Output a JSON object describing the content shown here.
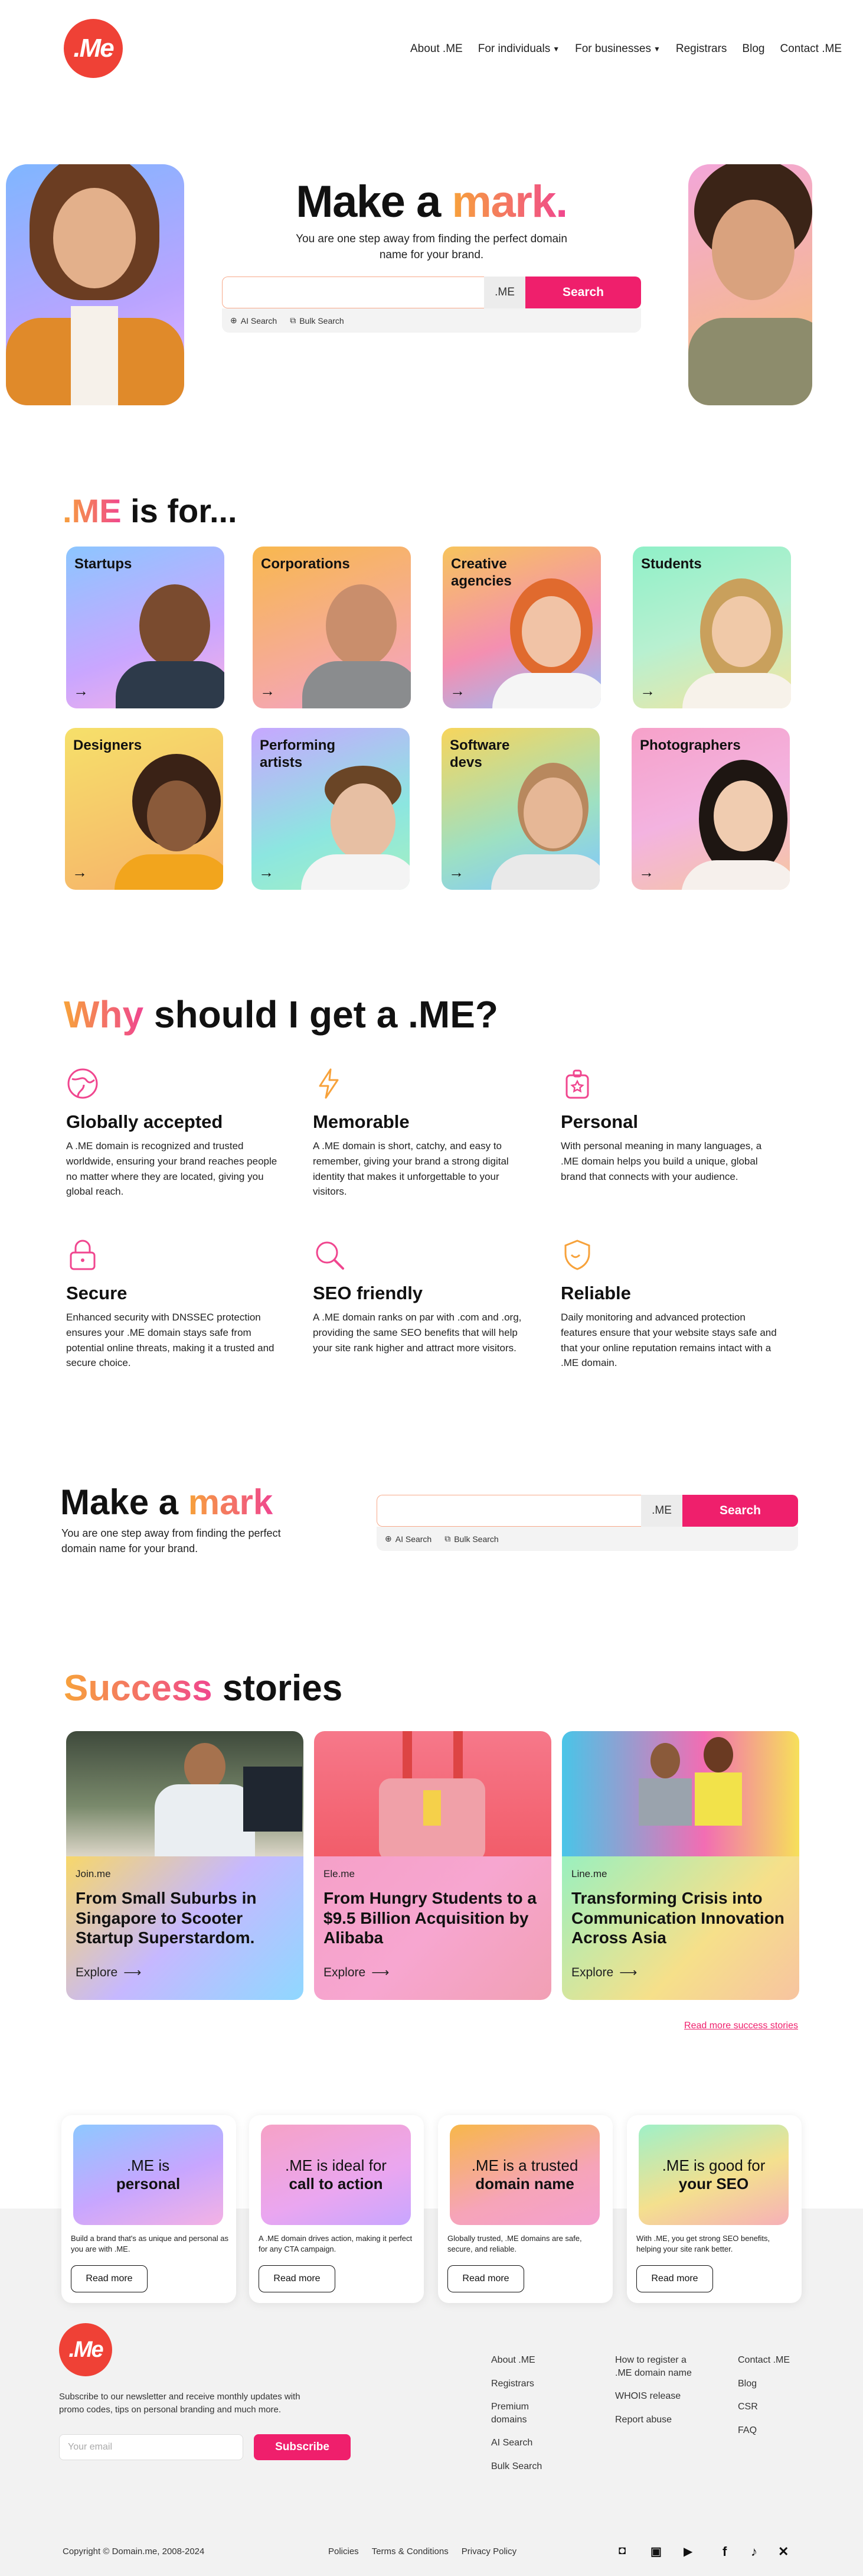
{
  "brand": {
    "logo_text": ".Me",
    "accent": "#ef4136",
    "pink": "#ef1f6c",
    "orange": "#f7a23b"
  },
  "nav": {
    "items": [
      "About .ME",
      "For individuals",
      "For businesses",
      "Registrars",
      "Blog",
      "Contact .ME"
    ]
  },
  "hero": {
    "title_a": "Make a ",
    "title_b": "mark.",
    "subtitle": "You are one step away from finding the perfect domain name for your brand.",
    "search_placeholder": "",
    "tld": ".ME",
    "search_label": "Search",
    "ai_search": "AI Search",
    "bulk_search": "Bulk Search"
  },
  "me_is_for": {
    "title_a": ".ME",
    "title_b": " is for...",
    "cards": [
      "Startups",
      "Corporations",
      "Creative agencies",
      "Students",
      "Designers",
      "Performing artists",
      "Software devs",
      "Photographers"
    ]
  },
  "why": {
    "title_a": "Why",
    "title_b": " should I get a .ME?",
    "features": [
      {
        "icon": "globe-icon",
        "title": "Globally accepted",
        "text": "A .ME domain is recognized and trusted worldwide, ensuring your brand reaches people no matter where they are located, giving you global reach."
      },
      {
        "icon": "lightning-icon",
        "title": "Memorable",
        "text": "A .ME domain is short, catchy, and easy to remember, giving your brand a strong digital identity that makes it unforgettable to your visitors."
      },
      {
        "icon": "badge-icon",
        "title": "Personal",
        "text": "With personal meaning in many languages, a .ME domain helps you build a unique, global brand that connects with your audience."
      },
      {
        "icon": "lock-icon",
        "title": "Secure",
        "text": "Enhanced security with DNSSEC protection ensures your .ME domain stays safe from potential online threats, making it a trusted and secure choice."
      },
      {
        "icon": "magnifier-icon",
        "title": "SEO friendly",
        "text": "A .ME domain ranks on par with .com and .org, providing the same SEO benefits that will help your site rank higher and attract more visitors."
      },
      {
        "icon": "shield-icon",
        "title": "Reliable",
        "text": "Daily monitoring and advanced protection features ensure that your website stays safe and that your online reputation remains intact with a .ME domain."
      }
    ]
  },
  "cta": {
    "title_a": "Make a ",
    "title_b": "mark",
    "subtitle": "You are one step away from finding the perfect domain name for your brand.",
    "tld": ".ME",
    "search_label": "Search",
    "ai_search": "AI Search",
    "bulk_search": "Bulk Search"
  },
  "stories": {
    "title_a": "Success",
    "title_b": " stories",
    "items": [
      {
        "site": "Join.me",
        "title": "From Small Suburbs in Singapore to Scooter Startup Superstardom.",
        "explore": "Explore"
      },
      {
        "site": "Ele.me",
        "title": "From Hungry Students to a $9.5 Billion Acquisition by Alibaba",
        "explore": "Explore"
      },
      {
        "site": "Line.me",
        "title": "Transforming Crisis into Communication Innovation Across Asia",
        "explore": "Explore"
      }
    ],
    "read_more": "Read more success stories"
  },
  "mini_cards": [
    {
      "line1": ".ME is",
      "line2": "personal",
      "text": "Build a brand that's as unique and personal as you are with .ME.",
      "button": "Read more"
    },
    {
      "line1": ".ME is ideal for",
      "line2": "call to action",
      "text": "A .ME domain drives action, making it perfect for any CTA campaign.",
      "button": "Read more"
    },
    {
      "line1": ".ME is a trusted",
      "line2": "domain name",
      "text": "Globally trusted, .ME domains are safe, secure, and reliable.",
      "button": "Read more"
    },
    {
      "line1": ".ME is good for",
      "line2": "your SEO",
      "text": "With .ME, you get strong SEO benefits, helping your site rank better.",
      "button": "Read more"
    }
  ],
  "footer": {
    "newsletter": "Subscribe to our newsletter and receive monthly updates with promo codes, tips on personal branding and much more.",
    "email_placeholder": "Your email",
    "subscribe": "Subscribe",
    "col1": [
      "About .ME",
      "Registrars",
      "Premium domains",
      "AI Search",
      "Bulk Search"
    ],
    "col2": [
      "How to register a .ME domain name",
      "WHOIS release",
      "Report abuse"
    ],
    "col3": [
      "Contact .ME",
      "Blog",
      "CSR",
      "FAQ"
    ],
    "copyright": "Copyright © Domain.me, 2008-2024",
    "legal": [
      "Policies",
      "Terms & Conditions",
      "Privacy Policy"
    ]
  }
}
